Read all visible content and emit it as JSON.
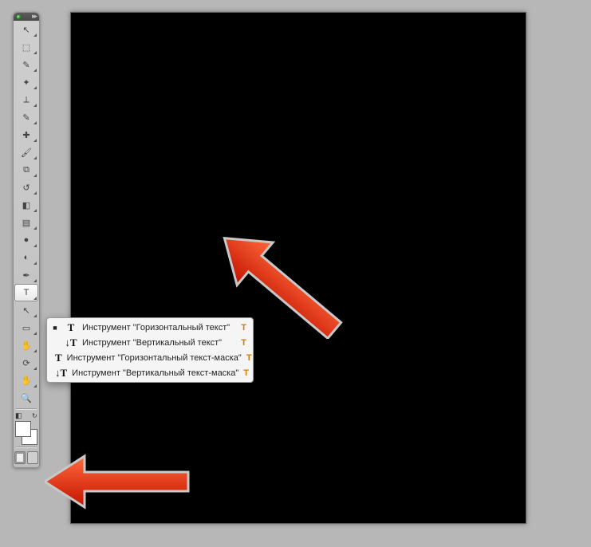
{
  "tools": [
    {
      "name": "move-tool",
      "glyph": "↖",
      "fly": true
    },
    {
      "name": "marquee-tool",
      "glyph": "⬚",
      "fly": true
    },
    {
      "name": "lasso-tool",
      "glyph": "✎",
      "fly": true
    },
    {
      "name": "magic-wand-tool",
      "glyph": "✦",
      "fly": true
    },
    {
      "name": "crop-tool",
      "glyph": "⟂",
      "fly": true
    },
    {
      "name": "eyedropper-tool",
      "glyph": "✎",
      "fly": true
    },
    {
      "name": "healing-brush-tool",
      "glyph": "✚",
      "fly": true
    },
    {
      "name": "brush-tool",
      "glyph": "🖌",
      "fly": true
    },
    {
      "name": "clone-stamp-tool",
      "glyph": "⧉",
      "fly": true
    },
    {
      "name": "history-brush-tool",
      "glyph": "↺",
      "fly": true
    },
    {
      "name": "eraser-tool",
      "glyph": "◧",
      "fly": true
    },
    {
      "name": "gradient-tool",
      "glyph": "▤",
      "fly": true
    },
    {
      "name": "blur-tool",
      "glyph": "●",
      "fly": true
    },
    {
      "name": "dodge-tool",
      "glyph": "◐",
      "fly": true
    },
    {
      "name": "pen-tool",
      "glyph": "✒",
      "fly": true
    },
    {
      "name": "type-tool",
      "glyph": "T",
      "fly": true,
      "selected": true
    },
    {
      "name": "path-selection-tool",
      "glyph": "↖",
      "fly": true
    },
    {
      "name": "shape-tool",
      "glyph": "▭",
      "fly": true
    },
    {
      "name": "hand-3d-tool",
      "glyph": "✋",
      "fly": true
    },
    {
      "name": "camera-3d-tool",
      "glyph": "⟳",
      "fly": true
    },
    {
      "name": "hand-tool",
      "glyph": "✋",
      "fly": true
    },
    {
      "name": "zoom-tool",
      "glyph": "🔍",
      "fly": false
    }
  ],
  "swatch": {
    "fg": "#ffffff",
    "bg": "#ffffff"
  },
  "flyout": {
    "items": [
      {
        "active": true,
        "label": "Инструмент \"Горизонтальный текст\"",
        "key": "T",
        "glyph": "T"
      },
      {
        "active": false,
        "label": "Инструмент \"Вертикальный текст\"",
        "key": "T",
        "glyph": "↓T"
      },
      {
        "active": false,
        "label": "Инструмент \"Горизонтальный текст-маска\"",
        "key": "T",
        "glyph": "T"
      },
      {
        "active": false,
        "label": "Инструмент \"Вертикальный текст-маска\"",
        "key": "T",
        "glyph": "↓T"
      }
    ]
  }
}
